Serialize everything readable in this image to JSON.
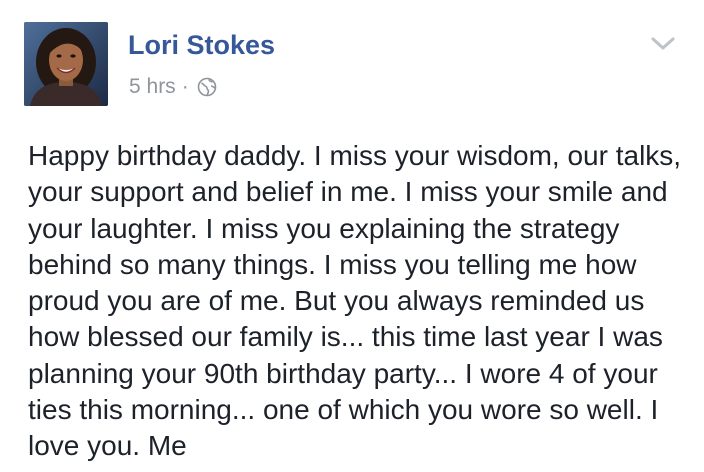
{
  "post": {
    "author_name": "Lori Stokes",
    "timestamp": "5 hrs",
    "separator": "·",
    "privacy_icon": "globe-icon",
    "menu_icon": "chevron-down-icon",
    "text_lines": [
      "Happy birthday daddy. I miss your wisdom, our talks,",
      "your support and belief in me. I miss your smile and",
      "your laughter. I miss you explaining the strategy",
      "behind so many things. I miss you telling me how",
      "proud you are of me. But you always reminded us",
      "how blessed our family is... this time last year I was",
      "planning your 90th birthday party... I wore 4 of your",
      "ties this morning... one of which you wore so well. I",
      "love you. Me"
    ]
  },
  "colors": {
    "author": "#365899",
    "meta": "#90949c",
    "body_text": "#1d2129",
    "background": "#ffffff"
  }
}
